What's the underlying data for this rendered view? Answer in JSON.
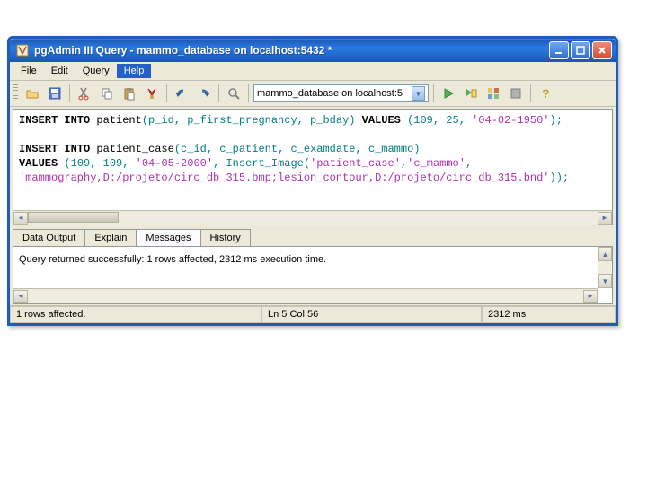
{
  "window": {
    "title": "pgAdmin III Query - mammo_database on localhost:5432 *"
  },
  "menu": {
    "file": "File",
    "edit": "Edit",
    "query": "Query",
    "help": "Help"
  },
  "toolbar": {
    "db_selected": "mammo_database on localhost:5"
  },
  "sql": {
    "l1a": "INSERT INTO",
    "l1b": " patient",
    "l1c": "(p_id, p_first_pregnancy, p_bday)",
    "l1d": " VALUES ",
    "l1e": "(109, 25, ",
    "l1f": "'04-02-1950'",
    "l1g": ");",
    "l2": "",
    "l3a": "INSERT INTO",
    "l3b": " patient_case",
    "l3c": "(c_id, c_patient, c_examdate, c_mammo)",
    "l4a": "VALUES ",
    "l4b": "(109, 109, ",
    "l4c": "'04-05-2000'",
    "l4d": ", Insert_Image(",
    "l4e": "'patient_case'",
    "l4f": ",",
    "l4g": "'c_mammo'",
    "l4h": ",",
    "l5a": "'mammography,D:/projeto/circ_db_315.bmp;lesion_contour,D:/projeto/circ_db_315.bnd'",
    "l5b": "));"
  },
  "tabs": {
    "data_output": "Data Output",
    "explain": "Explain",
    "messages": "Messages",
    "history": "History"
  },
  "output": {
    "message": "Query returned successfully: 1 rows affected, 2312 ms execution time."
  },
  "status": {
    "left": "1 rows affected.",
    "center": "Ln 5 Col 56",
    "right": "2312 ms"
  }
}
